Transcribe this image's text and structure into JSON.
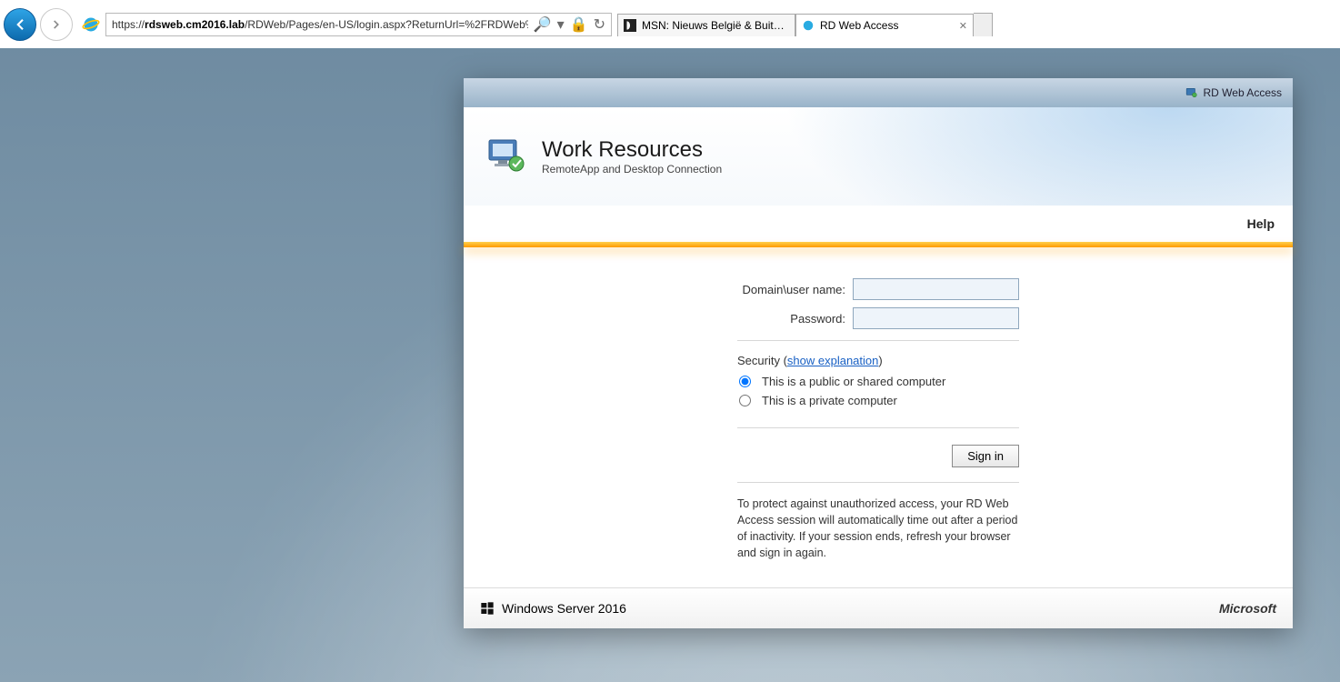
{
  "browser": {
    "url_host": "rdsweb.cm2016.lab",
    "url_prefix": "https://",
    "url_path": "/RDWeb/Pages/en-US/login.aspx?ReturnUrl=%2FRDWeb%",
    "tabs": [
      {
        "label": "MSN: Nieuws België & Buitenl..."
      },
      {
        "label": "RD Web Access"
      }
    ]
  },
  "window": {
    "top_label": "RD Web Access",
    "title": "Work Resources",
    "subtitle": "RemoteApp and Desktop Connection",
    "help": "Help",
    "form": {
      "user_label": "Domain\\user name:",
      "user_value": "",
      "pass_label": "Password:",
      "pass_value": "",
      "security_prefix": "Security (",
      "security_link": "show explanation",
      "security_suffix": ")",
      "opt_public": "This is a public or shared computer",
      "opt_private": "This is a private computer",
      "signin": "Sign in",
      "notice": "To protect against unauthorized access, your RD Web Access session will automatically time out after a period of inactivity. If your session ends, refresh your browser and sign in again."
    },
    "footer_left": "Windows Server 2016",
    "footer_right": "Microsoft"
  }
}
